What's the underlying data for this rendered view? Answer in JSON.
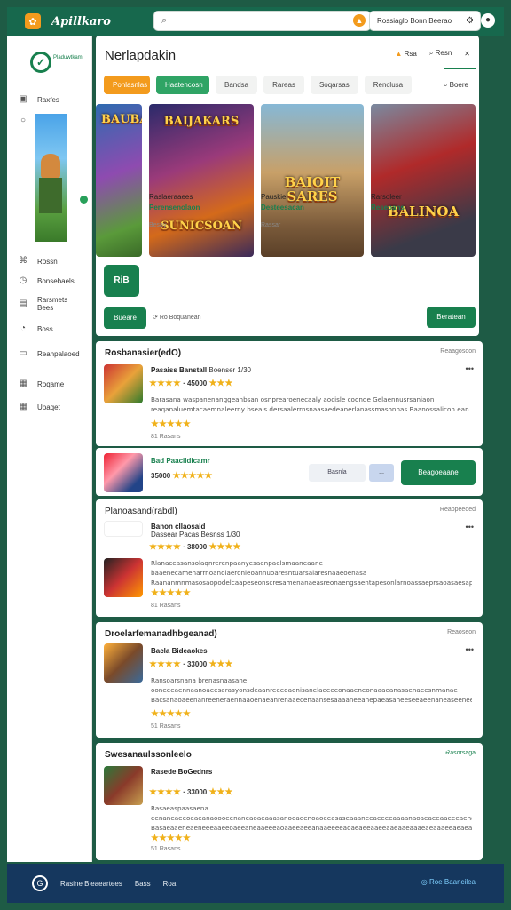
{
  "topbar": {
    "brand": "Apillkaro",
    "search_placeholder": "",
    "account_text": "Rossiaglo Bonn Beerao"
  },
  "sidebar": {
    "tagline": "Pladuwtkam",
    "items": [
      {
        "label": "Raxfes",
        "icon": "calendar-icon"
      },
      {
        "label": "",
        "icon": "search-icon"
      },
      {
        "label": "Rossn",
        "icon": "rocket-icon"
      },
      {
        "label": "Bonsebaels",
        "icon": "clock-icon"
      },
      {
        "label": "Rarsmets Bees",
        "icon": "lock-icon"
      },
      {
        "label": "Boss",
        "icon": "gauge-icon"
      },
      {
        "label": "Reanpalaoed",
        "icon": "monitor-icon"
      },
      {
        "label": "Roqame",
        "icon": "calendar-icon"
      },
      {
        "label": "Upaqet",
        "icon": "grid-icon"
      }
    ]
  },
  "panel": {
    "title": "Nerlapdakin",
    "tool1": "Rsa",
    "tool2": "Resn",
    "tool3": "✕",
    "chips": [
      "Ponlasnlas",
      "Haatencosn",
      "Bandsa",
      "Rareas",
      "Soqarsas",
      "Renclusa"
    ],
    "search": "Boere",
    "games": [
      {
        "title": "BAUBAI"
      },
      {
        "title": "BAIJAKARS",
        "sub": "SUNICSOAN"
      },
      {
        "title": "BAIOIT SARES"
      },
      {
        "title": "BALINOA"
      }
    ],
    "captions": [
      {
        "name": "Raslaeraaees",
        "price": "Perensenolaon",
        "meta": "Besay"
      },
      {
        "name": "Pauskie",
        "price": "Desteesacan",
        "meta": "Rassar"
      },
      {
        "name": "Rarsoleer",
        "price": "Reseoans",
        "meta": ""
      }
    ],
    "app_label": "RiB",
    "left_btn": "Bueare",
    "note": "Ro Boquanean",
    "right_btn": "Beratean"
  },
  "cards": [
    {
      "title": "Rosbanasier(edO)",
      "meta": "Reaagosoon",
      "app": "Pasaiss Banstall",
      "appmeta": "Boenser 1/30",
      "score": "45000",
      "desc": "Barasana waspanenanggeanbsan osnprearoenecaaly aocisle coonde Gelaennusrsaniaon reaqanaluemtacaemnaleerny bseals dersaalerrnsnaasaedeanerlanassmasonnas Baanossalicon ean derssrasnonaanas rsansorse plosleea Seropaplaas banalsaneosoo baneeasa baraas Baanoseamecolarepauuolenaaosieeacle",
      "count": "81 Rasans"
    },
    {
      "title": "Bad Paacildicamr",
      "score": "35000",
      "tag1": "Basnla",
      "tag2": "...",
      "btn": "Beagoeaane"
    },
    {
      "title": "Planoasand(rabdl)",
      "meta": "Reaopeeoed",
      "app": "Banon cllaosald",
      "appmeta": "Dassear Pacas Besnss 1/30",
      "score": "38000",
      "desc": "Rlanaceasansolaqnrerenpaanyesaenpaelsmaaneaane baaenecamenarrnoanolaeronieoannuoaresntuarsalaresnaaeoenasa Raananmnmasosaopodelcaapeseonscresamenanaeasreonaengsaentapesonlarnoassaeprsaoasaesapeceonaeenesnsaeseeo BsseeabarasaaneoaneensleraesnreonaeaeeanereaseoasnpeleesodenceeoceoaaleaaeaepesesnaacanaaaanesensmeoeyDeoase",
      "count": "81 Rasans"
    },
    {
      "title": "Droelarfemanadhbgeanad)",
      "meta": "Reaoseon",
      "app": "Bacla Bideaokes",
      "score": "33000",
      "desc": "Ransoarsnana brenasnaasane ooneeeaennaanoaeesarasyonsdeaanreeeoaenisanelaeeeeonaaeneonaaaeanasaenaeesnmanae Bacsanaoaeenanreeneraennaaoenaeanrenaaecenaansesaaaaneeanepaeasaneeseeaeenaneaseeneeoaoennearaaneesaneepeonrae Bosecslerseoseaceeaosoeanaeeneraaenaesaneaorraeasoeneneseaseolasaaeareenaaaenoeaeeeaaaeanaeaaeeoaa",
      "count": "51 Rasans"
    },
    {
      "title": "Swesanaulssonleelo",
      "meta": "Rasorsaga",
      "app": "Rasede BoGednrs",
      "score": "33000",
      "desc": "Rasaeaspaasaena eenaneaeeoeaeanaoooeenaneaoaeaaasanoeaeenoaoeeasaseaaaneeaeeeeaaaanaoaeaeeaaeeeaenaaaeaneaeea Basaeaaeneaeneeeaaeeoaeeaneaaeeeaoaaeeaeeanaaeeeeaoaeaeeaaeeaaeaaeaaaeaeaaaeeaeaeaeaanaeaeeaeeeee Baoeaeaeaeaeaeeaaeaeaeeaaeeaeaeaeaeaeaeaeaaeeaeaeaeaeaeeaeeaeeaeaaeaeaeaeeaeaeaaeeeaaea",
      "count": "51 Rasans"
    }
  ],
  "footer": {
    "links": [
      "Rasine Bieaeartees",
      "Bass",
      "Roa"
    ],
    "right": "Roe Baancilea"
  }
}
